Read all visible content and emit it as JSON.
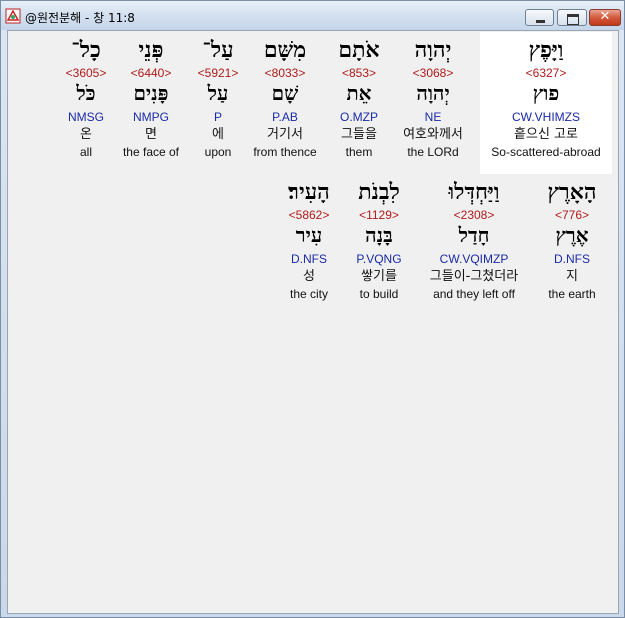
{
  "window": {
    "title": "@원전분해 - 창 11:8",
    "minimize_icon": "minimize-icon",
    "maximize_icon": "maximize-icon",
    "close_label": "✕"
  },
  "rows": [
    {
      "words": [
        {
          "hebrew": "וַיָּפֶץ",
          "strong": "<6327>",
          "lemma": "פוץ",
          "parse": "CW.VHIMZS",
          "korean": "흩으신 고로",
          "english": "So-scattered-abroad",
          "selected": true
        },
        {
          "hebrew": "יְהוָה",
          "strong": "<3068>",
          "lemma": "יְהוָה",
          "parse": "NE",
          "korean": "여호와께서",
          "english": "the LORd"
        },
        {
          "hebrew": "אֹתָם",
          "strong": "<853>",
          "lemma": "אֵת",
          "parse": "O.MZP",
          "korean": "그들을",
          "english": "them"
        },
        {
          "hebrew": "מִשָּׁם",
          "strong": "<8033>",
          "lemma": "שָׁם",
          "parse": "P.AB",
          "korean": "거기서",
          "english": "from thence"
        },
        {
          "hebrew": "עַל־",
          "strong": "<5921>",
          "lemma": "עַל",
          "parse": "P",
          "korean": "에",
          "english": "upon"
        },
        {
          "hebrew": "פְּנֵי",
          "strong": "<6440>",
          "lemma": "פָּנִים",
          "parse": "NMPG",
          "korean": "면",
          "english": "the face of"
        },
        {
          "hebrew": "כָל־",
          "strong": "<3605>",
          "lemma": "כֹּל",
          "parse": "NMSG",
          "korean": "온",
          "english": "all"
        }
      ]
    },
    {
      "words": [
        {
          "hebrew": "הָאָרֶץ",
          "strong": "<776>",
          "lemma": "אֶרֶץ",
          "parse": "D.NFS",
          "korean": "지",
          "english": "the earth"
        },
        {
          "hebrew": "וַיַּחְדְּלוּ",
          "strong": "<2308>",
          "lemma": "חָדַל",
          "parse": "CW.VQIMZP",
          "korean": "그들이-그쳤더라",
          "english": "and they left off"
        },
        {
          "hebrew": "לִבְנֹת",
          "strong": "<1129>",
          "lemma": "בָּנָה",
          "parse": "P.VQNG",
          "korean": "쌓기를",
          "english": "to build"
        },
        {
          "hebrew": "הָעִיר׃",
          "strong": "<5862>",
          "lemma": "עִיר",
          "parse": "D.NFS",
          "korean": "성",
          "english": "the city"
        }
      ]
    }
  ]
}
